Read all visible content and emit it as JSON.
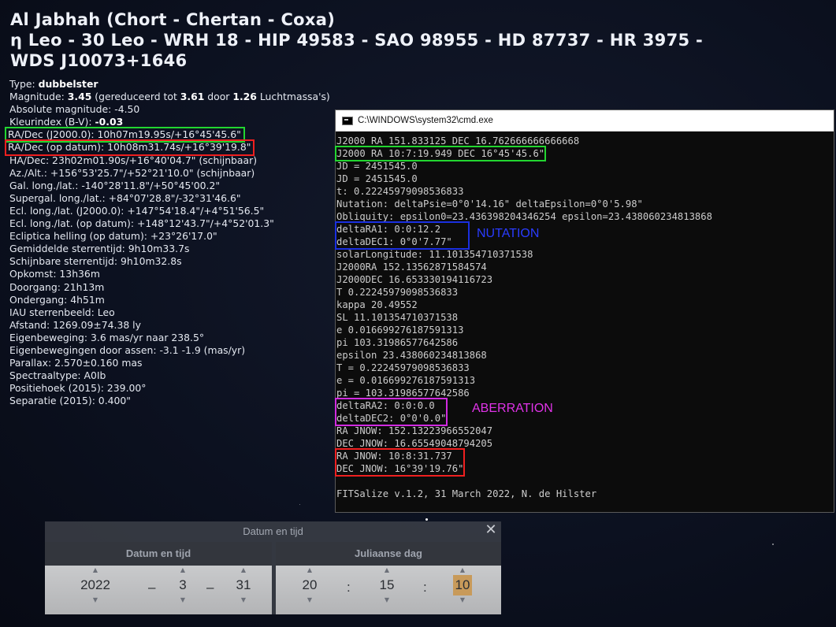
{
  "object": {
    "title_line1": "Al Jabhah (Chort - Chertan - Coxa)",
    "title_line2": "η Leo - 30 Leo - WRH 18 - HIP 49583 - SAO 98955 - HD 87737 - HR 3975 -",
    "title_line3": "WDS J10073+1646"
  },
  "info": {
    "type_label": "Type: ",
    "type_value": "dubbelster",
    "mag_label": "Magnitude: ",
    "mag_value": "3.45",
    "mag_mid1": " (gereduceerd tot ",
    "mag_value2": "3.61",
    "mag_mid2": " door ",
    "mag_value3": "1.26",
    "mag_end": " Luchtmassa's)",
    "absmag": "Absolute magnitude: -4.50",
    "color_label": "Kleurindex (B-V): ",
    "color_value": "-0.03",
    "radec_j2000": "RA/Dec (J2000.0): 10h07m19.95s/+16°45'45.6\"",
    "radec_date": "RA/Dec (op datum): 10h08m31.74s/+16°39'19.8\"",
    "rows": [
      "HA/Dec: 23h02m01.90s/+16°40'04.7\" (schijnbaar)",
      "Az./Alt.: +156°53'25.7\"/+52°21'10.0\" (schijnbaar)",
      "Gal. long./lat.: -140°28'11.8\"/+50°45'00.2\"",
      "Supergal. long./lat.: +84°07'28.8\"/-32°31'46.6\"",
      "Ecl. long./lat. (J2000.0): +147°54'18.4\"/+4°51'56.5\"",
      "Ecl. long./lat. (op datum): +148°12'43.7\"/+4°52'01.3\"",
      "Ecliptica helling (op datum): +23°26'17.0\"",
      "Gemiddelde sterrentijd: 9h10m33.7s",
      "Schijnbare sterrentijd: 9h10m32.8s",
      "Opkomst: 13h36m",
      "Doorgang: 21h13m",
      "Ondergang: 4h51m",
      "IAU sterrenbeeld: Leo",
      "Afstand: 1269.09±74.38 ly",
      "Eigenbeweging: 3.6 mas/yr naar 238.5°",
      "Eigenbewegingen door assen: -3.1 -1.9 (mas/yr)",
      "Parallax: 2.570±0.160 mas",
      "Spectraaltype: A0Ib",
      "Positiehoek (2015): 239.00°",
      "Separatie (2015): 0.400\""
    ]
  },
  "cmd": {
    "title": "C:\\WINDOWS\\system32\\cmd.exe",
    "l1": "J2000 RA 151.833125 DEC 16.762666666666668",
    "l2": "J2000 RA 10:7:19.949 DEC 16°45'45.6\"",
    "l3": "JD = 2451545.0",
    "l4": "JD = 2451545.0",
    "l5": "t: 0.22245979098536833",
    "l6": "Nutation: deltaPsie=0°0'14.16\" deltaEpsilon=0°0'5.98\"",
    "l7": "Obliquity: epsilon0=23.436398204346254 epsilon=23.438060234813868",
    "l8": "deltaRA1: 0:0:12.2",
    "l9": "deltaDEC1: 0°0'7.77\"",
    "nutation_tag": "NUTATION",
    "l10": "solarLongitude: 11.101354710371538",
    "l11": "J2000RA 152.13562871584574",
    "l12": "J2000DEC 16.653330194116723",
    "l13": "T 0.22245979098536833",
    "l14": "kappa 20.49552",
    "l15": "SL 11.101354710371538",
    "l16": "e 0.016699276187591313",
    "l17": "pi 103.31986577642586",
    "l18": "epsilon 23.438060234813868",
    "l19": "T = 0.22245979098536833",
    "l20": "e = 0.016699276187591313",
    "l21": "pi = 103.31986577642586",
    "l22": "deltaRA2: 0:0:0.0",
    "l23": "deltaDEC2: 0°0'0.0\"",
    "aberration_tag": "ABERRATION",
    "l24": "RA JNOW: 152.13223966552047",
    "l25": "DEC JNOW: 16.65549048794205",
    "l26": "RA JNOW: 10:8:31.737",
    "l27": "DEC JNOW: 16°39'19.76\"",
    "l28": "",
    "l29": "FITSalize v.1.2, 31 March 2022, N. de Hilster"
  },
  "datetime": {
    "title": "Datum en tijd",
    "date_header": "Datum en tijd",
    "jd_header": "Juliaanse dag",
    "year": "2022",
    "month": "3",
    "day": "31",
    "hour": "20",
    "minute": "15",
    "second": "10",
    "dash": "–",
    "colon": ":"
  }
}
